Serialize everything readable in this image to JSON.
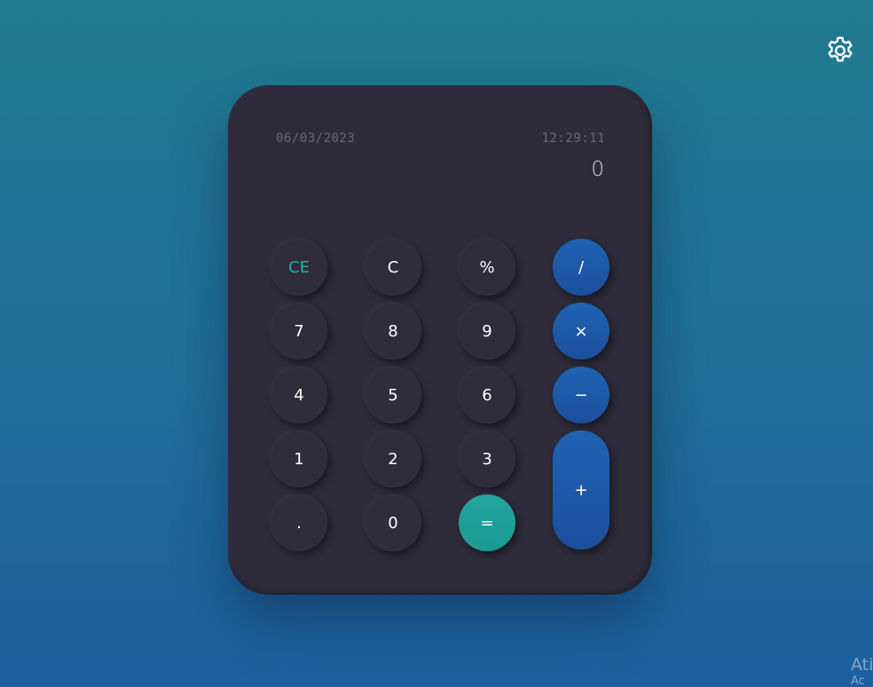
{
  "header": {
    "settings_icon": "gear-icon"
  },
  "calculator": {
    "date": "06/03/2023",
    "time": "12:29:11",
    "display_value": "0",
    "keys": {
      "ce": "CE",
      "c": "C",
      "percent": "%",
      "divide": "/",
      "seven": "7",
      "eight": "8",
      "nine": "9",
      "multiply": "×",
      "four": "4",
      "five": "5",
      "six": "6",
      "subtract": "−",
      "one": "1",
      "two": "2",
      "three": "3",
      "add": "+",
      "decimal": ".",
      "zero": "0",
      "equals": "="
    }
  },
  "colors": {
    "background_top": "#217a8f",
    "background_bottom": "#1d5f9f",
    "calculator_body": "#2e2b3a",
    "operator_key": "#1d5aa8",
    "equals_key": "#1f9f96",
    "ce_text": "#22b2a2"
  },
  "watermark": {
    "line1": "Ati",
    "line2": "Ac"
  }
}
